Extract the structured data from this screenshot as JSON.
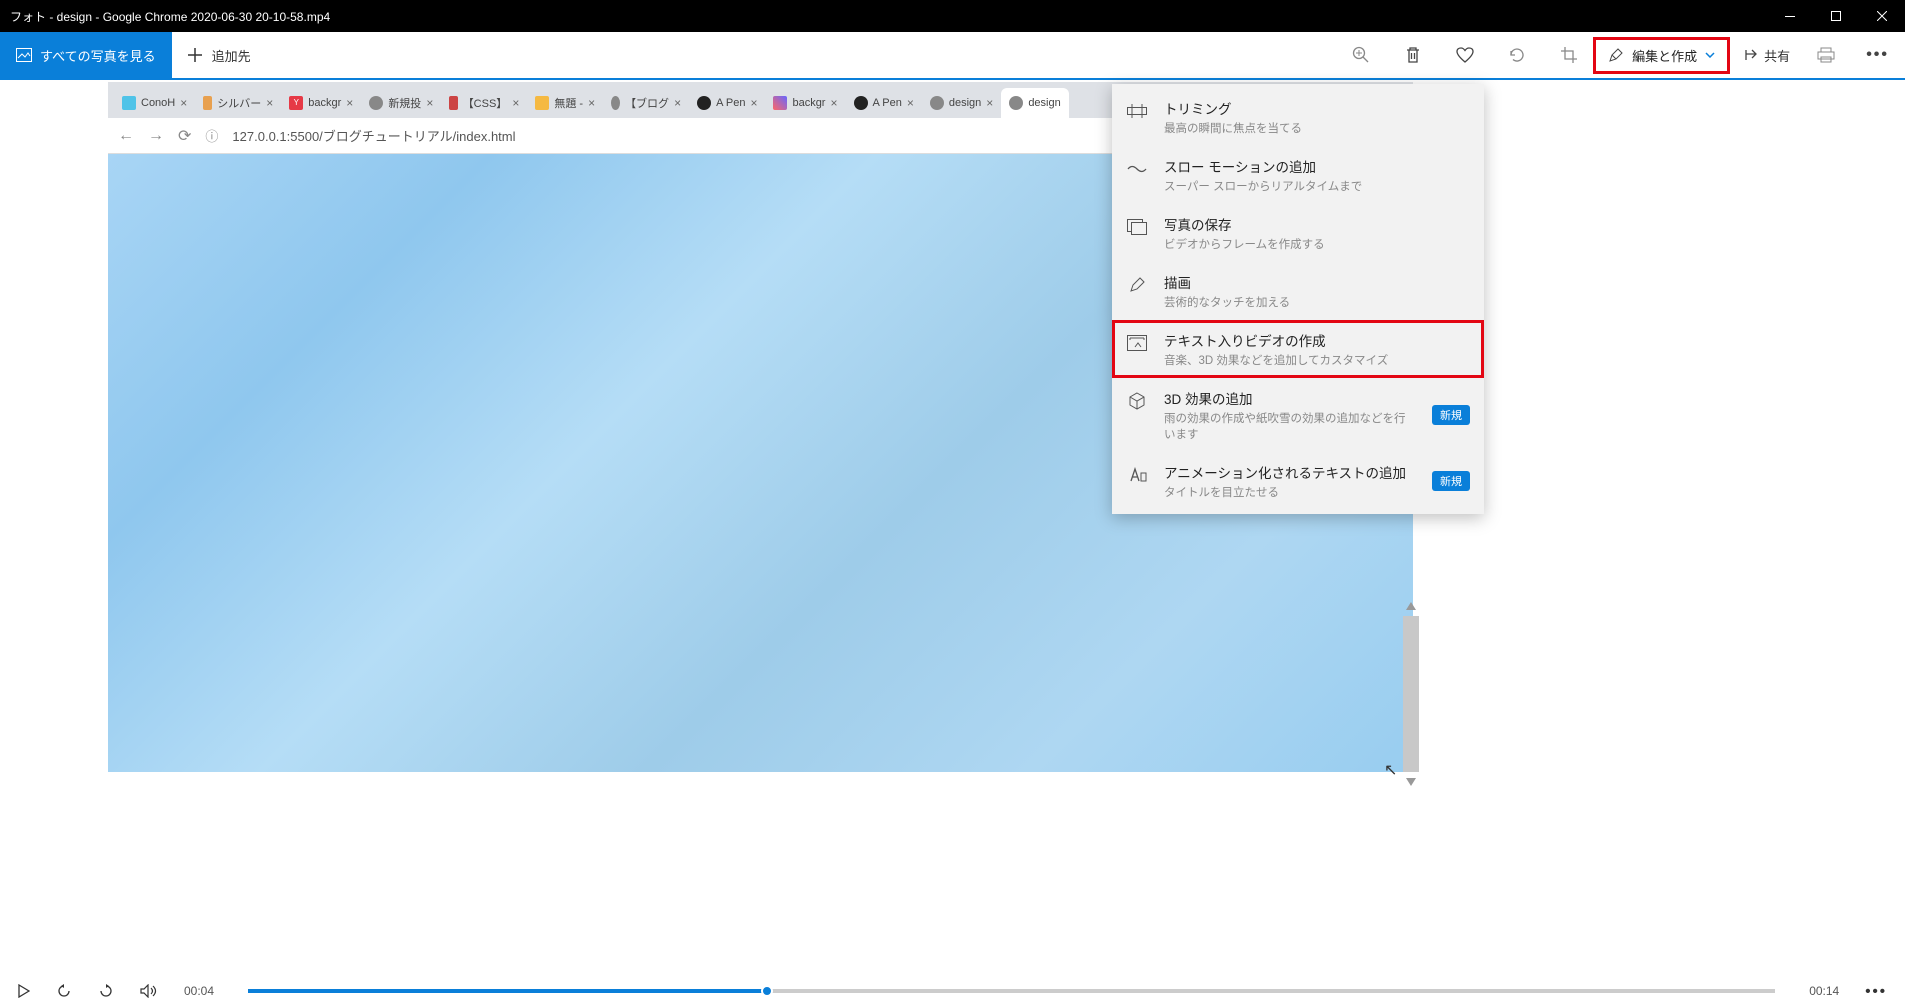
{
  "window": {
    "title": "フォト - design - Google Chrome 2020-06-30 20-10-58.mp4"
  },
  "toolbar": {
    "view_all": "すべての写真を見る",
    "add_to": "追加先",
    "edit_create": "編集と作成",
    "share": "共有"
  },
  "dropdown": {
    "items": [
      {
        "title": "トリミング",
        "sub": "最高の瞬間に焦点を当てる"
      },
      {
        "title": "スロー モーションの追加",
        "sub": "スーパー スローからリアルタイムまで"
      },
      {
        "title": "写真の保存",
        "sub": "ビデオからフレームを作成する"
      },
      {
        "title": "描画",
        "sub": "芸術的なタッチを加える"
      },
      {
        "title": "テキスト入りビデオの作成",
        "sub": "音楽、3D 効果などを追加してカスタマイズ"
      },
      {
        "title": "3D 効果の追加",
        "sub": "雨の効果の作成や紙吹雪の効果の追加などを行います",
        "badge": "新規"
      },
      {
        "title": "アニメーション化されるテキストの追加",
        "sub": "タイトルを目立たせる",
        "badge": "新規"
      }
    ]
  },
  "chrome": {
    "address": "127.0.0.1:5500/ブログチュートリアル/index.html",
    "tabs": [
      {
        "label": "ConoH"
      },
      {
        "label": "シルバー"
      },
      {
        "label": "backgr"
      },
      {
        "label": "新規投"
      },
      {
        "label": "【CSS】"
      },
      {
        "label": "無題 -"
      },
      {
        "label": "【ブログ"
      },
      {
        "label": "A Pen"
      },
      {
        "label": "backgr"
      },
      {
        "label": "A Pen"
      },
      {
        "label": "design"
      },
      {
        "label": "design"
      }
    ]
  },
  "video": {
    "current": "00:04",
    "total": "00:14"
  }
}
